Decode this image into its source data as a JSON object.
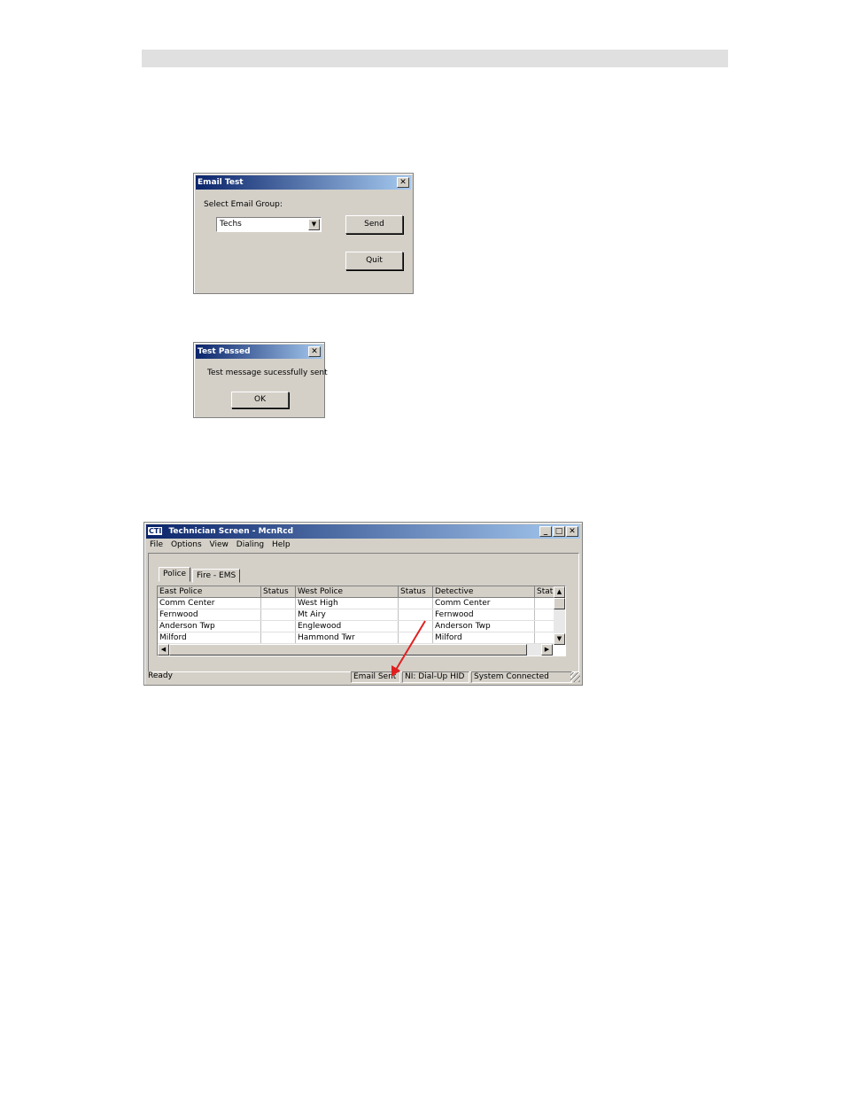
{
  "email_test": {
    "title": "Email Test",
    "select_label": "Select Email Group:",
    "group_value": "Techs",
    "send_label": "Send",
    "quit_label": "Quit"
  },
  "test_passed": {
    "title": "Test Passed",
    "message": "Test message sucessfully sent",
    "ok_label": "OK"
  },
  "tech_screen": {
    "logo": "CTI",
    "title": "Technician Screen - McnRcd",
    "menu": [
      "File",
      "Options",
      "View",
      "Dialing",
      "Help"
    ],
    "tabs": [
      "Police",
      "Fire - EMS"
    ],
    "columns": [
      "East Police",
      "Status",
      "West Police",
      "Status",
      "Detective",
      "Statu"
    ],
    "rows": [
      [
        "Comm Center",
        "",
        "West High",
        "",
        "Comm Center",
        ""
      ],
      [
        "Fernwood",
        "",
        "Mt Airy",
        "",
        "Fernwood",
        ""
      ],
      [
        "Anderson Twp",
        "",
        "Englewood",
        "",
        "Anderson Twp",
        ""
      ],
      [
        "Milford",
        "",
        "Hammond Twr",
        "",
        "Milford",
        ""
      ]
    ],
    "status": [
      "Ready",
      "Email Sent",
      "NI: Dial-Up HID",
      "System Connected"
    ]
  },
  "colors": {
    "annotation_arrow": "#e02020",
    "title_start": "#0a246a",
    "title_end": "#a6caf0"
  }
}
